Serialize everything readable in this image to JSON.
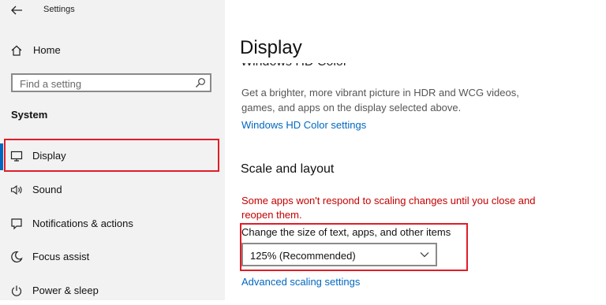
{
  "window": {
    "title": "Settings"
  },
  "sidebar": {
    "home_label": "Home",
    "search_placeholder": "Find a setting",
    "section_title": "System",
    "items": [
      {
        "label": "Display",
        "icon": "monitor-icon",
        "selected": true
      },
      {
        "label": "Sound",
        "icon": "speaker-icon"
      },
      {
        "label": "Notifications & actions",
        "icon": "notification-icon"
      },
      {
        "label": "Focus assist",
        "icon": "moon-icon"
      },
      {
        "label": "Power & sleep",
        "icon": "power-icon"
      }
    ]
  },
  "main": {
    "page_title": "Display",
    "clipped_heading": "Windows HD Color",
    "hd_description": "Get a brighter, more vibrant picture in HDR and WCG videos, games, and apps on the display selected above.",
    "hd_link": "Windows HD Color settings",
    "scale_heading": "Scale and layout",
    "warning": "Some apps won't respond to scaling changes until you close and reopen them.",
    "change_label": "Change the size of text, apps, and other items",
    "scale_value": "125% (Recommended)",
    "advanced_link": "Advanced scaling settings"
  },
  "colors": {
    "accent": "#0067c0",
    "highlight": "#e01d27",
    "warning": "#c40000"
  }
}
